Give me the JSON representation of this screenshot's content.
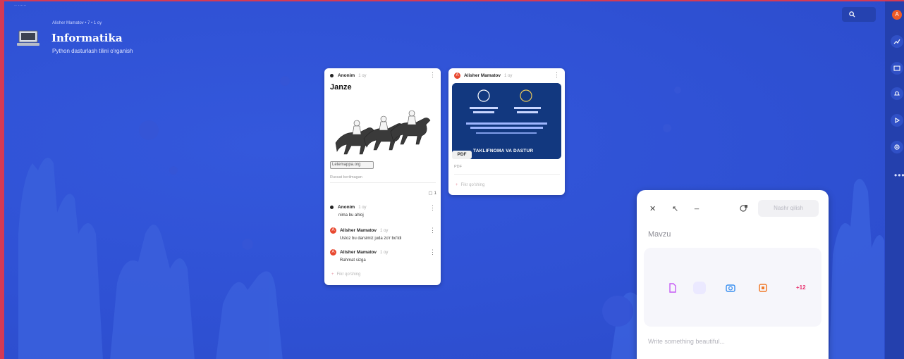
{
  "window": {
    "tiny_label": "·· ······"
  },
  "header": {
    "breadcrumb": "Alisher Mamatov • 7 • 1 oy",
    "title": "Informatika",
    "subtitle": "Python dasturlash tilini o'rganish"
  },
  "card1": {
    "author": "Anonim",
    "time": "1 oy",
    "title": "Janze",
    "link_label": "Letemappa.org",
    "link_caption": "Ruxsat berilmagan",
    "comment_count": "1",
    "comments": [
      {
        "author": "Anonim",
        "time": "1 oy",
        "text": "nima bu ahloj",
        "avatar": "dot"
      },
      {
        "author": "Alisher Mamatov",
        "time": "1 oy",
        "text": "Ustoz bu darsimiz juda zo'r bo'ldi",
        "avatar": "A"
      },
      {
        "author": "Alisher Mamatov",
        "time": "1 oy",
        "text": "Rahmat sizga",
        "avatar": "A"
      }
    ],
    "add_comment": "Fikr qo'shing"
  },
  "card2": {
    "author": "Alisher Mamatov",
    "time": "1 oy",
    "avatar": "A",
    "pdf_badge": "PDF",
    "pdf_banner": "TAKLIFNOMA VA DASTUR",
    "pdf_caption": "PDF",
    "add_comment": "Fikr qo'shing"
  },
  "composer": {
    "publish_label": "Nashr qilish",
    "topic_placeholder": "Mavzu",
    "body_placeholder": "Write something beautiful...",
    "more_label": "+12",
    "colors": {
      "doc": "#c65cf5",
      "camera": "#3a8ff0",
      "link": "#f07a2a",
      "more": "#e8306d"
    }
  },
  "sidebar": {
    "avatar": "A"
  },
  "colors": {
    "background": "#2f51d4",
    "accent_red": "#e8482f",
    "sidebar": "#2440ad"
  }
}
